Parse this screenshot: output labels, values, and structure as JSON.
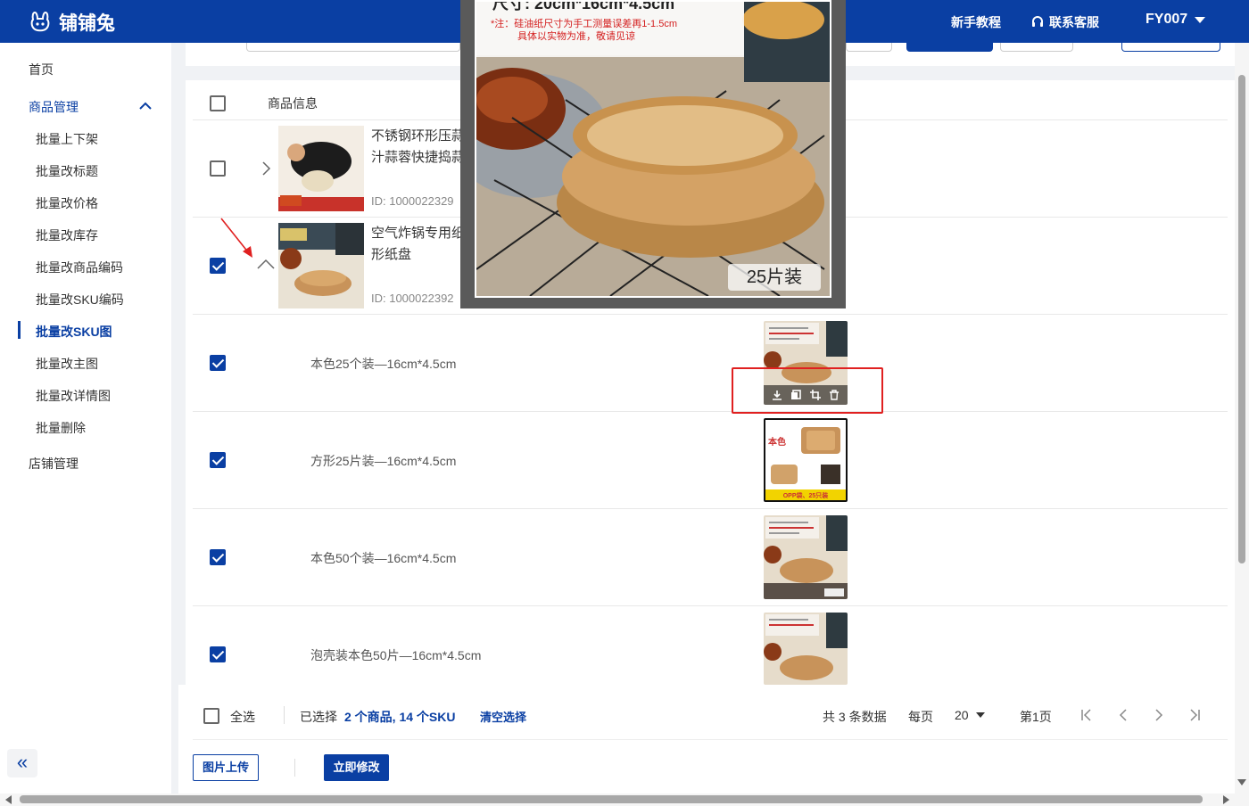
{
  "app": {
    "title": "铺铺兔",
    "tutorial": "新手教程",
    "support": "联系客服",
    "user": "FY007"
  },
  "sidebar": {
    "home": "首页",
    "product_mgmt": "商品管理",
    "items": [
      "批量上下架",
      "批量改标题",
      "批量改价格",
      "批量改库存",
      "批量改商品编码",
      "批量改SKU编码",
      "批量改SKU图",
      "批量改主图",
      "批量改详情图",
      "批量删除"
    ],
    "store_mgmt": "店铺管理",
    "collapse_glyph": "«"
  },
  "table": {
    "header": "商品信息",
    "products": [
      {
        "title_line1": "不锈钢环形压蒜",
        "title_line2": "汁蒜蓉快捷捣蒜",
        "id": "ID: 1000022329",
        "expanded": false,
        "checked": false
      },
      {
        "title_line1": "空气炸锅专用纸",
        "title_line2": "形纸盘",
        "id": "ID: 1000022392",
        "expanded": true,
        "checked": true
      }
    ],
    "skus": [
      {
        "name": "本色25个装—16cm*4.5cm",
        "checked": true
      },
      {
        "name": "方形25片装—16cm*4.5cm",
        "checked": true
      },
      {
        "name": "本色50个装—16cm*4.5cm",
        "checked": true
      },
      {
        "name": "泡壳装本色50片—16cm*4.5cm",
        "checked": true
      }
    ]
  },
  "footer": {
    "select_all": "全选",
    "selected_prefix": "已选择",
    "selected_count": "2 个商品, 14 个SKU",
    "clear": "清空选择",
    "total": "共 3 条数据",
    "per_page_label": "每页",
    "per_page": "20",
    "page": "第1页",
    "upload_button": "图片上传",
    "modify_button": "立即修改"
  },
  "preview": {
    "size_text": "尺寸: 20cm*16cm*4.5cm",
    "note_line1": "*注：硅油纸尺寸为手工测量误差再1-1.5cm",
    "note_line2": "具体以实物为准，敬请见谅",
    "pack_label": "25片装"
  },
  "sku_image_text": {
    "square_label": "本色",
    "square_caption": "OPP袋、25只装"
  },
  "colors": {
    "primary": "#0a3fa3",
    "highlight": "#e02020"
  }
}
